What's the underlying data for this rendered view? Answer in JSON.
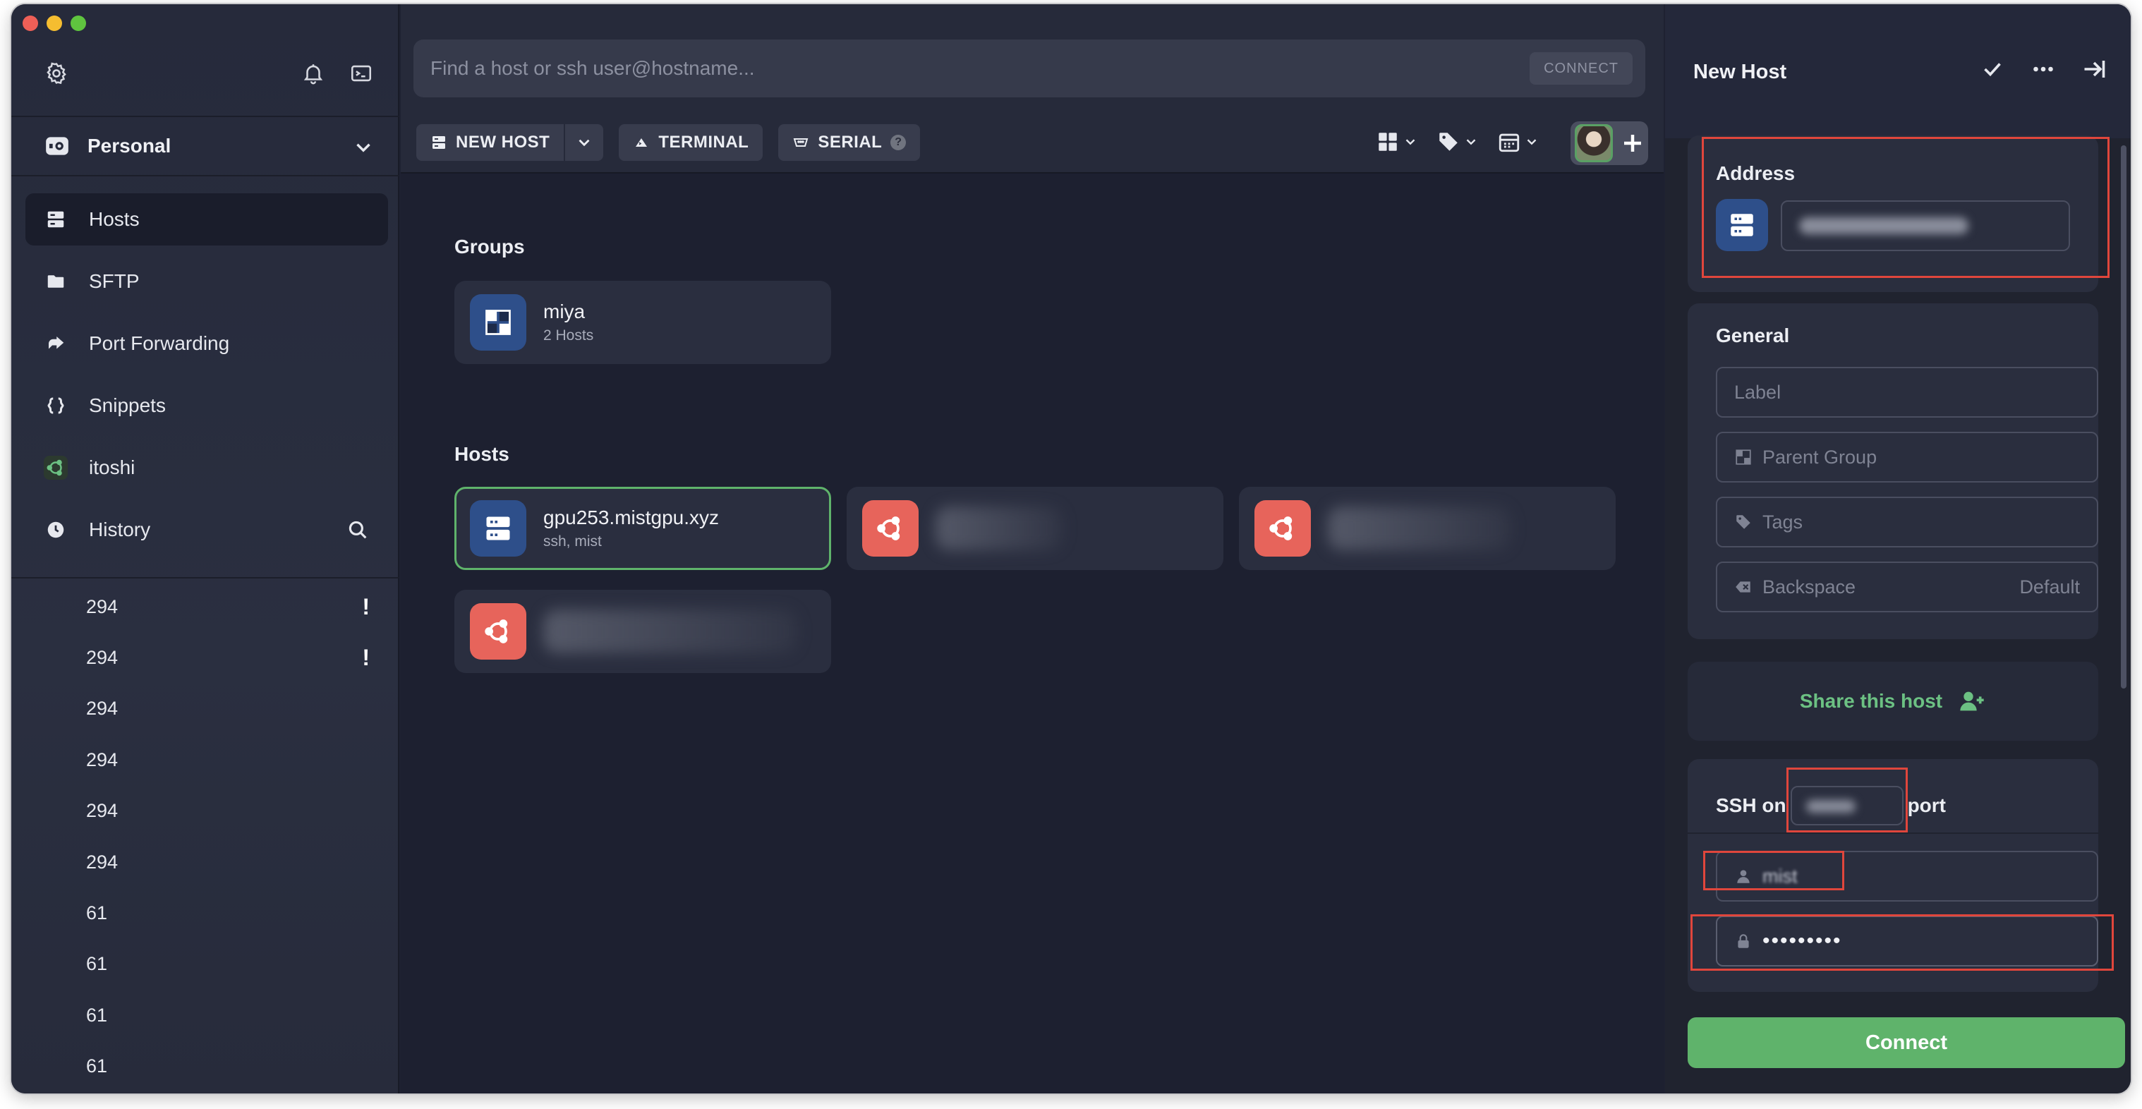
{
  "sidebar": {
    "vault": {
      "name": "Personal"
    },
    "nav": [
      {
        "label": "Hosts",
        "icon": "hosts-icon",
        "active": true
      },
      {
        "label": "SFTP",
        "icon": "folder-icon"
      },
      {
        "label": "Port Forwarding",
        "icon": "port-forwarding-icon"
      },
      {
        "label": "Snippets",
        "icon": "braces-icon"
      },
      {
        "label": "itoshi",
        "icon": "ubuntu-icon"
      },
      {
        "label": "History",
        "icon": "clock-icon"
      }
    ],
    "history": [
      {
        "label": "294",
        "warning": "!"
      },
      {
        "label": "294",
        "warning": "!"
      },
      {
        "label": "294"
      },
      {
        "label": "294"
      },
      {
        "label": "294"
      },
      {
        "label": "294"
      },
      {
        "label": "61"
      },
      {
        "label": "61"
      },
      {
        "label": "61"
      },
      {
        "label": "61"
      }
    ]
  },
  "main": {
    "search": {
      "placeholder": "Find a host or ssh user@hostname...",
      "connect_label": "CONNECT"
    },
    "toolbar": {
      "new_host": "NEW HOST",
      "terminal": "TERMINAL",
      "serial": "SERIAL",
      "serial_badge": "?"
    },
    "groups_title": "Groups",
    "groups": [
      {
        "name": "miya",
        "sub": "2 Hosts"
      }
    ],
    "hosts_title": "Hosts",
    "hosts": [
      {
        "name": "gpu253.mistgpu.xyz",
        "sub": "ssh, mist",
        "selected": true,
        "os": "server"
      }
    ]
  },
  "panel": {
    "title": "New Host",
    "address": {
      "label": "Address"
    },
    "general": {
      "label": "General",
      "label_placeholder": "Label",
      "parent_group_placeholder": "Parent Group",
      "tags_placeholder": "Tags",
      "backspace_label": "Backspace",
      "backspace_value": "Default"
    },
    "share_label": "Share this host",
    "ssh": {
      "prefix": "SSH on",
      "suffix": "port",
      "username": "mist",
      "password": "•••••••••"
    },
    "connect_label": "Connect"
  },
  "colors": {
    "accent_green": "#5fb36b",
    "highlight_red": "#e0463c",
    "host_blue": "#2e4f8a",
    "ubuntu_red": "#e7645b"
  }
}
